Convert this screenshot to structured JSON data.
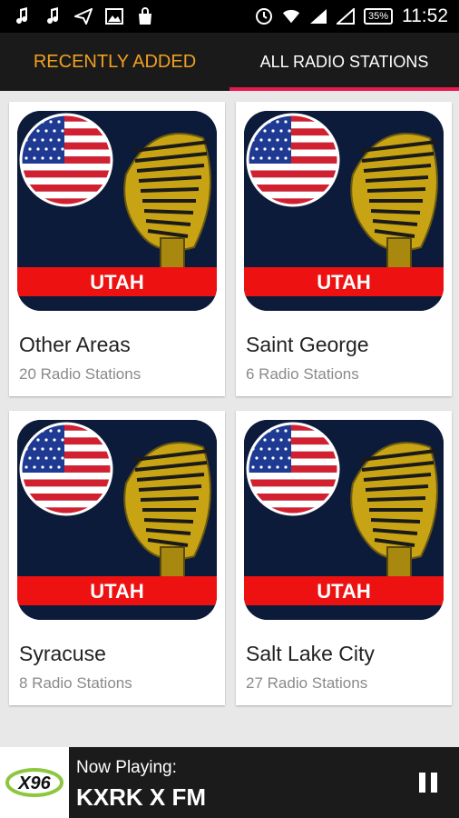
{
  "status_bar": {
    "time": "11:52",
    "battery": "35%"
  },
  "tabs": [
    {
      "label": "RECENTLY ADDED",
      "active": false
    },
    {
      "label": "ALL RADIO STATIONS",
      "active": true
    }
  ],
  "colors": {
    "accent": "#e8194f",
    "tab_highlight": "#f0a020",
    "thumb_bg": "#0d1b3a",
    "banner_red": "#ee1111"
  },
  "stations": [
    {
      "name": "Other Areas",
      "count": "20 Radio Stations",
      "banner": "UTAH"
    },
    {
      "name": "Saint George",
      "count": "6 Radio Stations",
      "banner": "UTAH"
    },
    {
      "name": "Syracuse",
      "count": "8 Radio Stations",
      "banner": "UTAH"
    },
    {
      "name": "Salt Lake City",
      "count": "27 Radio Stations",
      "banner": "UTAH"
    }
  ],
  "player": {
    "label": "Now Playing:",
    "station": "KXRK X FM",
    "logo_text": "X96"
  }
}
